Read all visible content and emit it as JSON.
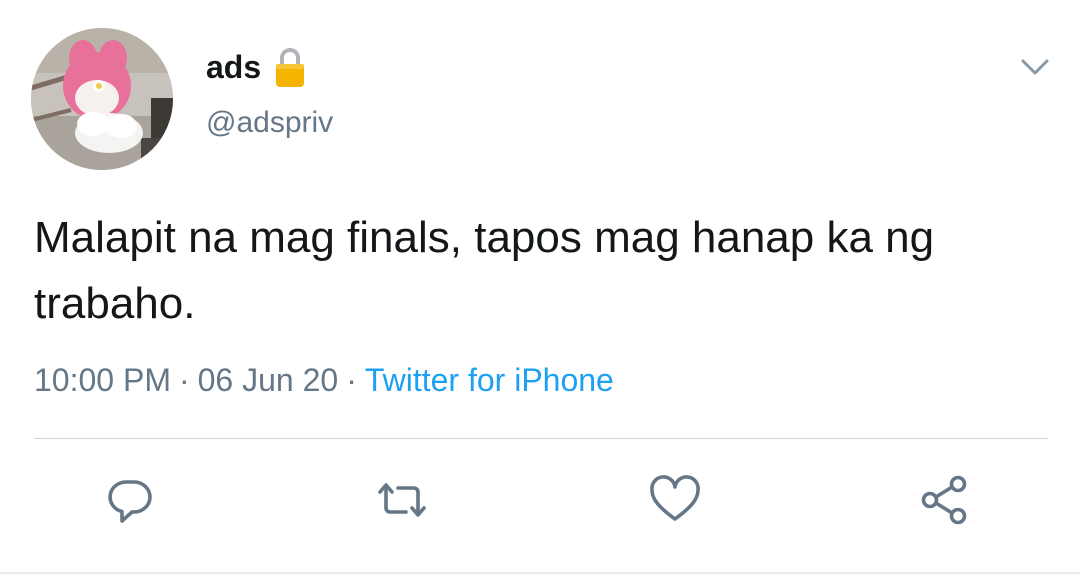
{
  "user": {
    "display_name": "ads",
    "handle": "@adspriv",
    "protected_icon": "lock-icon",
    "avatar_icon": "cartoon-avatar"
  },
  "tweet": {
    "text": "Malapit na mag finals, tapos mag hanap ka ng trabaho.",
    "time": "10:00 PM",
    "date": "06 Jun 20",
    "source": "Twitter for iPhone",
    "separator": "·"
  },
  "actions": {
    "reply_icon": "reply-icon",
    "retweet_icon": "retweet-icon",
    "like_icon": "heart-icon",
    "share_icon": "share-icon",
    "menu_icon": "chevron-down-icon"
  },
  "colors": {
    "text": "#14171a",
    "secondary": "#657786",
    "link": "#1da1f2",
    "divider": "#ccd6dd"
  }
}
